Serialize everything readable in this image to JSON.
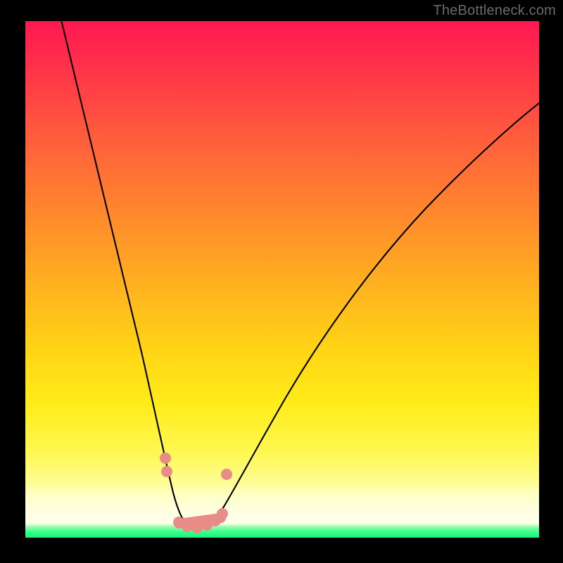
{
  "watermark": "TheBottleneck.com",
  "chart_data": {
    "type": "line",
    "title": "",
    "xlabel": "",
    "ylabel": "",
    "xlim": [
      0,
      100
    ],
    "ylim": [
      0,
      100
    ],
    "series": [
      {
        "name": "bottleneck-curve",
        "x": [
          7,
          10,
          14,
          18,
          22,
          25,
          27,
          29,
          30.5,
          32,
          34,
          36,
          38,
          42,
          48,
          56,
          66,
          78,
          90,
          100
        ],
        "values": [
          100,
          89,
          75,
          60,
          43,
          28,
          17,
          9,
          4,
          2,
          2,
          4,
          8,
          15,
          26,
          40,
          54,
          66,
          76,
          83
        ]
      }
    ],
    "annotations": [
      {
        "name": "marker-left-top",
        "x": 27.0,
        "y": 13.5
      },
      {
        "name": "marker-left-mid",
        "x": 27.5,
        "y": 11.0
      },
      {
        "name": "marker-flat-a",
        "x": 29.5,
        "y": 3.0
      },
      {
        "name": "marker-flat-b",
        "x": 31.0,
        "y": 2.0
      },
      {
        "name": "marker-flat-c",
        "x": 33.0,
        "y": 2.0
      },
      {
        "name": "marker-flat-d",
        "x": 35.0,
        "y": 2.5
      },
      {
        "name": "marker-flat-e",
        "x": 36.5,
        "y": 4.0
      },
      {
        "name": "marker-flat-f",
        "x": 38.0,
        "y": 6.0
      },
      {
        "name": "marker-right",
        "x": 39.0,
        "y": 13.0
      }
    ],
    "gradient_stops": [
      {
        "pos": 0,
        "color": "#ff1852"
      },
      {
        "pos": 22,
        "color": "#ff5b3d"
      },
      {
        "pos": 52,
        "color": "#ffb41e"
      },
      {
        "pos": 74,
        "color": "#ffec18"
      },
      {
        "pos": 96,
        "color": "#fcffd2"
      },
      {
        "pos": 100,
        "color": "#17f676"
      }
    ]
  }
}
